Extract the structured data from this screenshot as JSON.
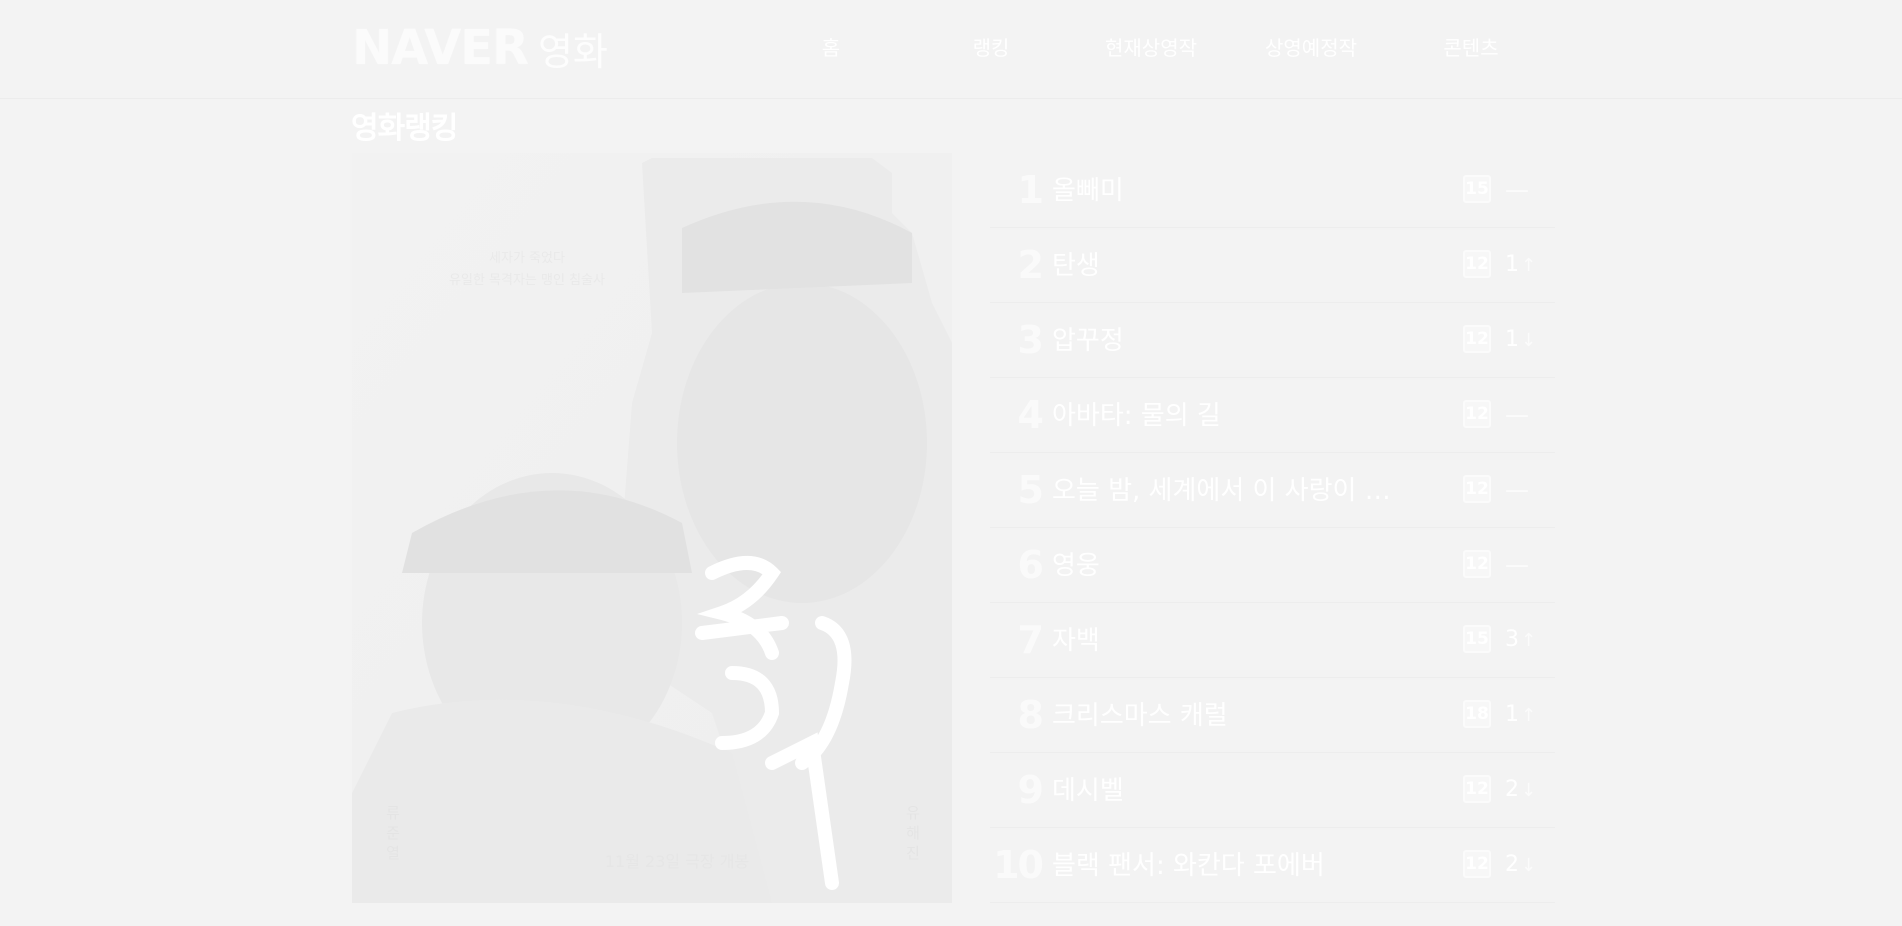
{
  "header": {
    "logo_brand": "NAVER",
    "logo_section": "영화",
    "nav": [
      {
        "label": "홈"
      },
      {
        "label": "랭킹"
      },
      {
        "label": "현재상영작"
      },
      {
        "label": "상영예정작"
      },
      {
        "label": "콘텐츠"
      }
    ]
  },
  "page_title": "영화랭킹",
  "poster": {
    "tagline_1": "세자가 죽었다",
    "tagline_2": "유일한 목격자는 맹인 침술사",
    "title": "올빼미",
    "release": "11월 23일 극장 개봉",
    "cast_left": "류준열",
    "cast_right": "유해진"
  },
  "ranking": [
    {
      "rank": "1",
      "title": "올빼미",
      "rating": "15",
      "change": "",
      "direction": "same"
    },
    {
      "rank": "2",
      "title": "탄생",
      "rating": "12",
      "change": "1",
      "direction": "up"
    },
    {
      "rank": "3",
      "title": "압꾸정",
      "rating": "12",
      "change": "1",
      "direction": "down"
    },
    {
      "rank": "4",
      "title": "아바타: 물의 길",
      "rating": "12",
      "change": "",
      "direction": "same"
    },
    {
      "rank": "5",
      "title": "오늘 밤, 세계에서 이 사랑이 사라진다 해도",
      "rating": "12",
      "change": "",
      "direction": "same"
    },
    {
      "rank": "6",
      "title": "영웅",
      "rating": "12",
      "change": "",
      "direction": "same"
    },
    {
      "rank": "7",
      "title": "자백",
      "rating": "15",
      "change": "3",
      "direction": "up"
    },
    {
      "rank": "8",
      "title": "크리스마스 캐럴",
      "rating": "18",
      "change": "1",
      "direction": "up"
    },
    {
      "rank": "9",
      "title": "데시벨",
      "rating": "12",
      "change": "2",
      "direction": "down"
    },
    {
      "rank": "10",
      "title": "블랙 팬서: 와칸다 포에버",
      "rating": "12",
      "change": "2",
      "direction": "down"
    }
  ]
}
